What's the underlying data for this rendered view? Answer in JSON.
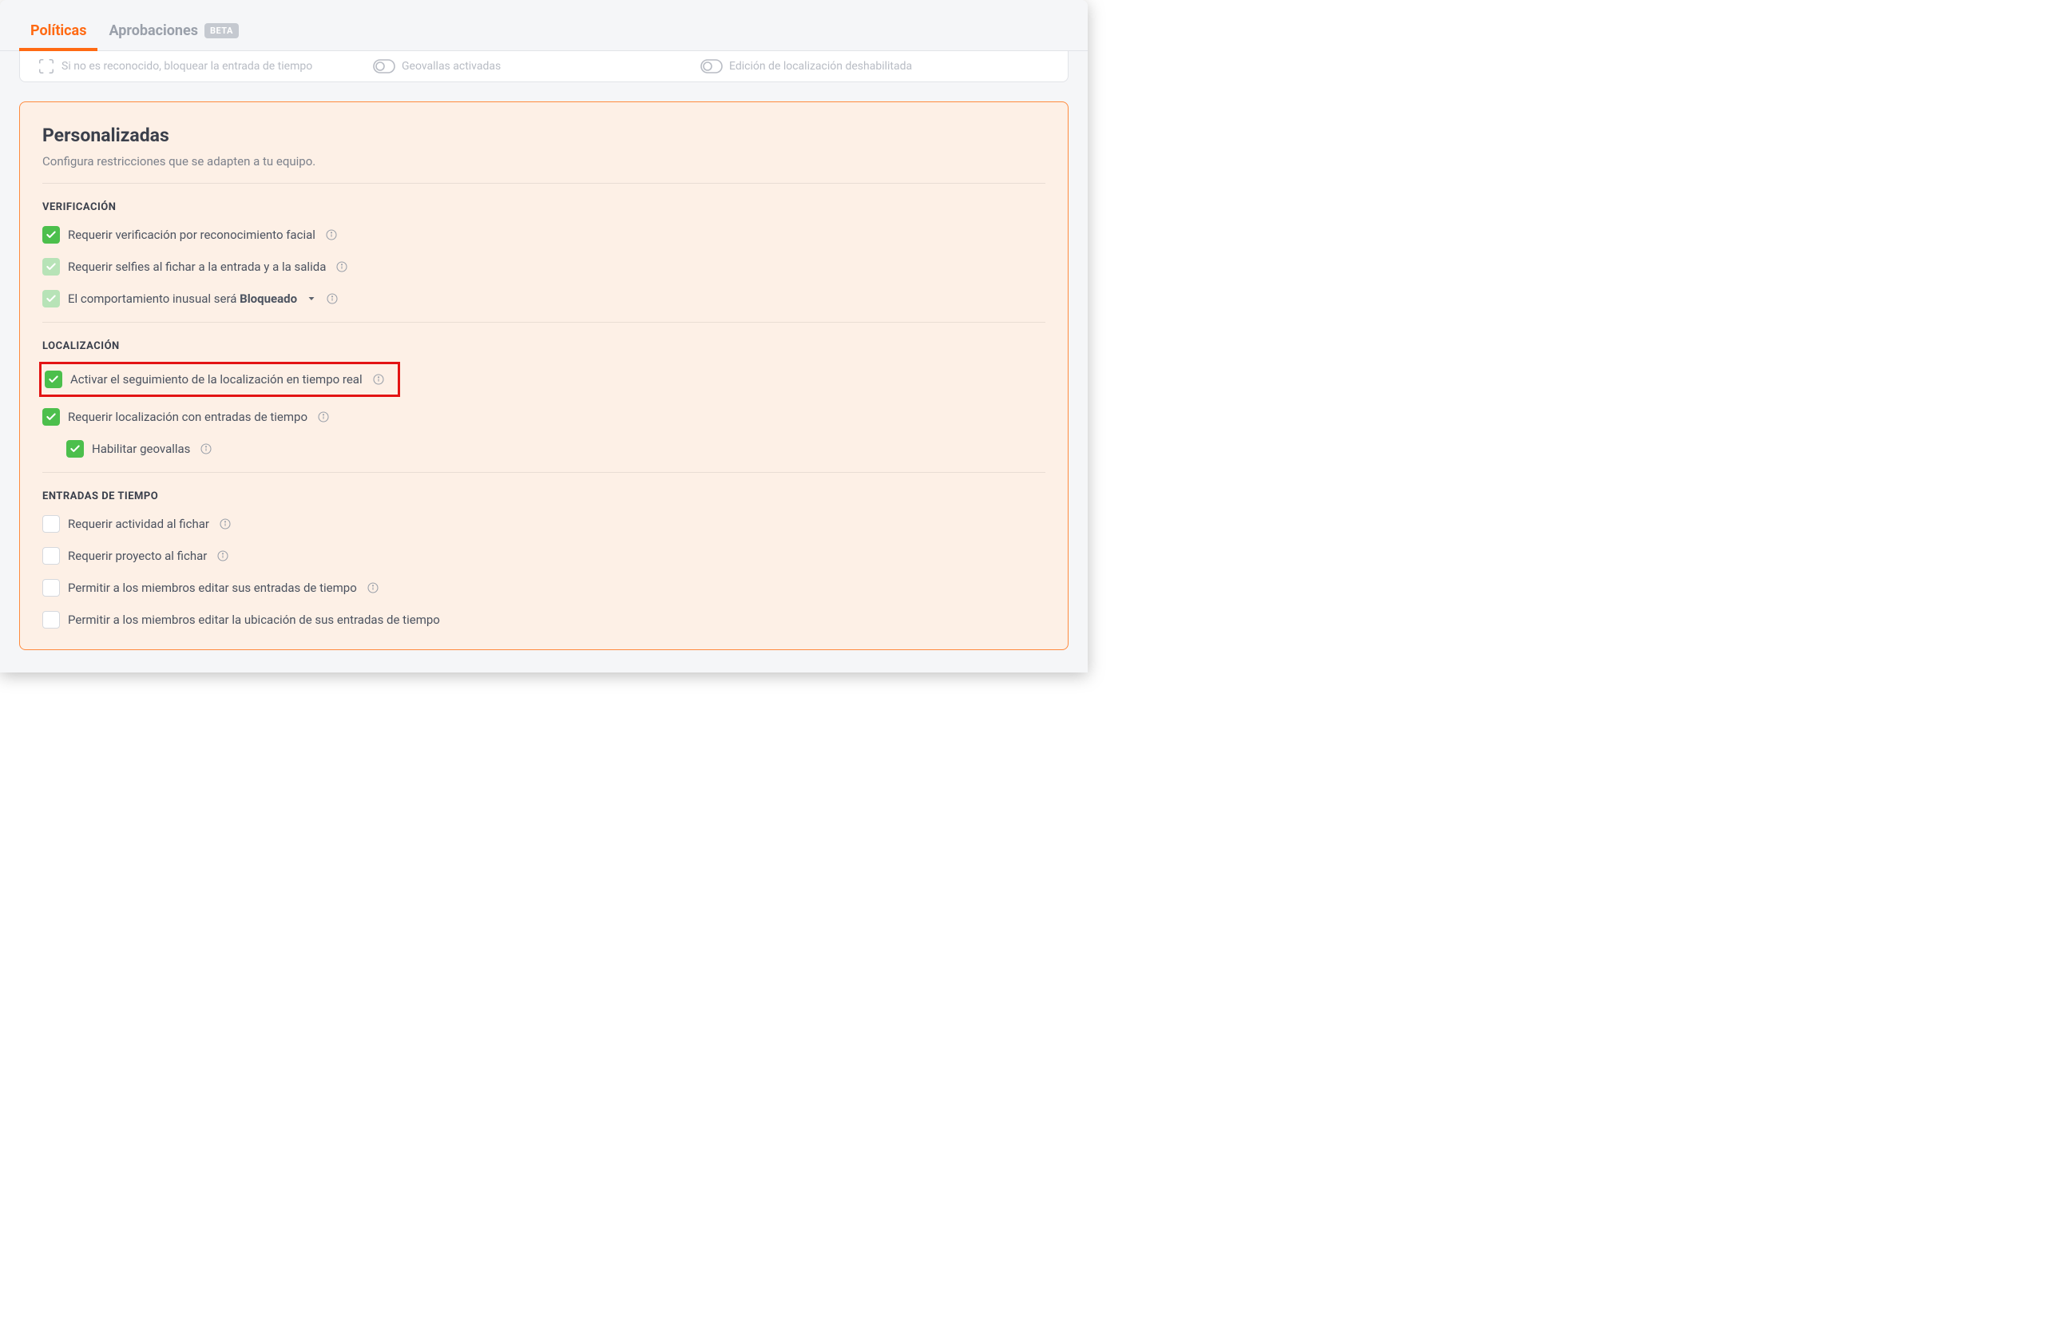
{
  "tabs": {
    "policies": "Políticas",
    "approvals": "Aprobaciones",
    "beta_badge": "BETA"
  },
  "peek": {
    "item1": "Si no es reconocido, bloquear la entrada de tiempo",
    "item2": "Geovallas activadas",
    "item3": "Edición de localización deshabilitada"
  },
  "panel": {
    "title": "Personalizadas",
    "subtitle": "Configura restricciones que se adapten a tu equipo."
  },
  "sections": {
    "verification": {
      "label": "VERIFICACIÓN",
      "face": "Requerir verificación por reconocimiento facial",
      "selfies": "Requerir selfies al fichar a la entrada y a la salida",
      "behavior_pre": "El comportamiento inusual será ",
      "behavior_bold": "Bloqueado"
    },
    "location": {
      "label": "LOCALIZACIÓN",
      "realtime": "Activar el seguimiento de la localización en tiempo real",
      "require_loc": "Requerir localización con entradas de tiempo",
      "geofence": "Habilitar geovallas"
    },
    "entries": {
      "label": "ENTRADAS DE TIEMPO",
      "activity": "Requerir actividad al fichar",
      "project": "Requerir proyecto al fichar",
      "edit_entries": "Permitir a los miembros editar sus entradas de tiempo",
      "edit_location": "Permitir a los miembros editar la ubicación de sus entradas de tiempo"
    }
  }
}
